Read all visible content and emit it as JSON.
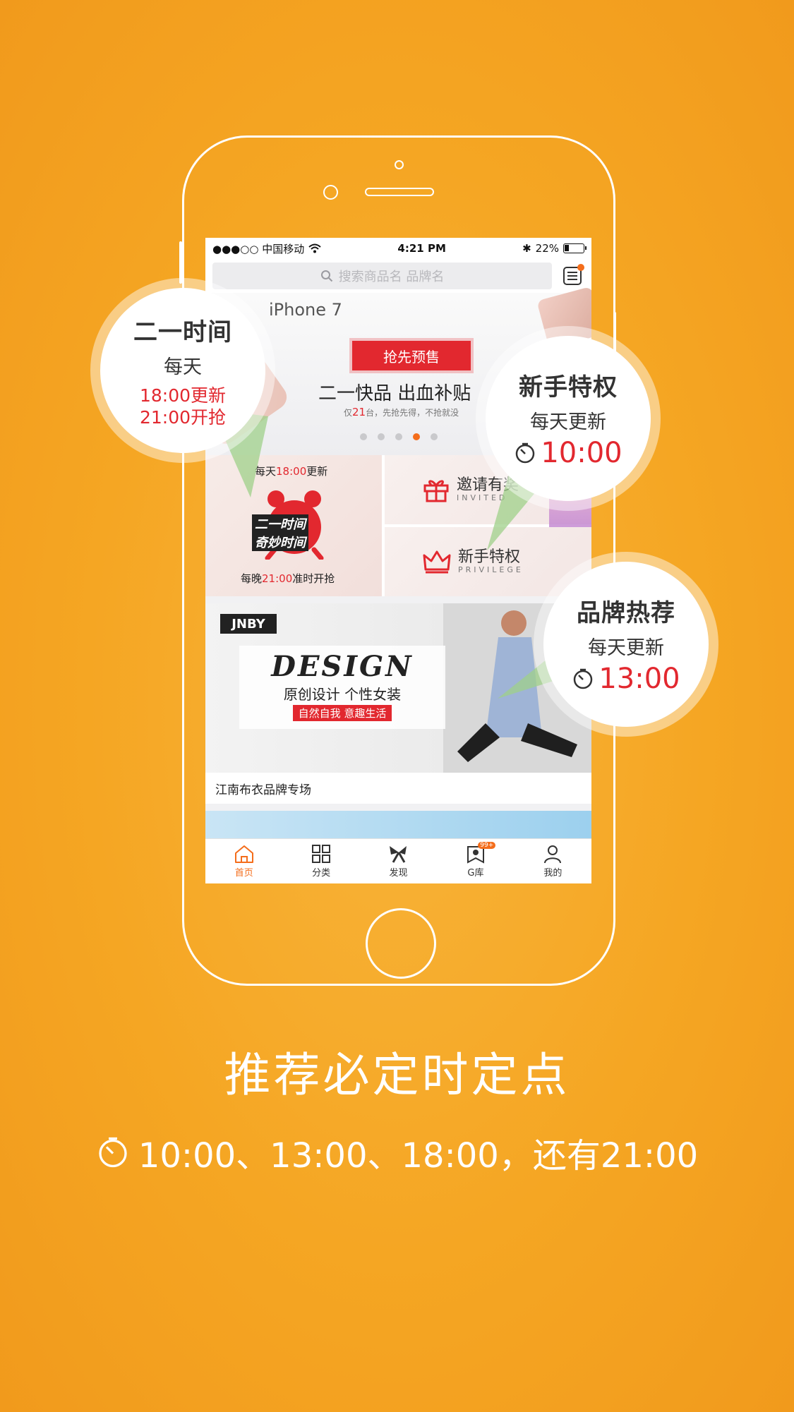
{
  "status_bar": {
    "carrier": "●●●○○ 中国移动",
    "time": "4:21 PM",
    "battery": "22%"
  },
  "search": {
    "placeholder": "搜索商品名 品牌名"
  },
  "banner": {
    "product": "iPhone 7",
    "button": "抢先预售",
    "title": "二一快品  出血补贴",
    "sub_prefix": "仅",
    "sub_count": "21",
    "sub_suffix": "台，先抢先得，不抢就没",
    "active_dot": 3
  },
  "grid": {
    "top_prefix": "每天",
    "top_time": "18:00",
    "top_suffix": "更新",
    "clock_text_1": "二一时间",
    "clock_text_2": "奇妙时间",
    "bottom_prefix": "每晚",
    "bottom_time": "21:00",
    "bottom_suffix": "准时开抢",
    "invite_title": "邀请有奖",
    "invite_en": "INVITED",
    "privilege_title": "新手特权",
    "privilege_en": "PRIVILEGE"
  },
  "brand": {
    "logo": "JNBY",
    "design": "DESIGN",
    "design_sub": "原创设计 个性女装",
    "tag": "自然自我 意趣生活",
    "caption": "江南布衣品牌专场"
  },
  "tabs": [
    {
      "label": "首页",
      "icon": "home-icon",
      "active": true
    },
    {
      "label": "分类",
      "icon": "category-grid-icon",
      "active": false
    },
    {
      "label": "发现",
      "icon": "bow-icon",
      "active": false
    },
    {
      "label": "G库",
      "icon": "g-library-icon",
      "active": false,
      "badge": "99+"
    },
    {
      "label": "我的",
      "icon": "profile-icon",
      "active": false
    }
  ],
  "callouts": {
    "left": {
      "title": "二一时间",
      "sub": "每天",
      "time1": "18:00更新",
      "time2": "21:00开抢"
    },
    "right_top": {
      "title": "新手特权",
      "sub": "每天更新",
      "time": "10:00"
    },
    "right_bottom": {
      "title": "品牌热荐",
      "sub": "每天更新",
      "time": "13:00"
    }
  },
  "headline": "推荐必定时定点",
  "subline": "10:00、13:00、18:00，还有21:00",
  "colors": {
    "background": "#f5a623",
    "accent": "#f46d1b",
    "red": "#e2282f"
  }
}
